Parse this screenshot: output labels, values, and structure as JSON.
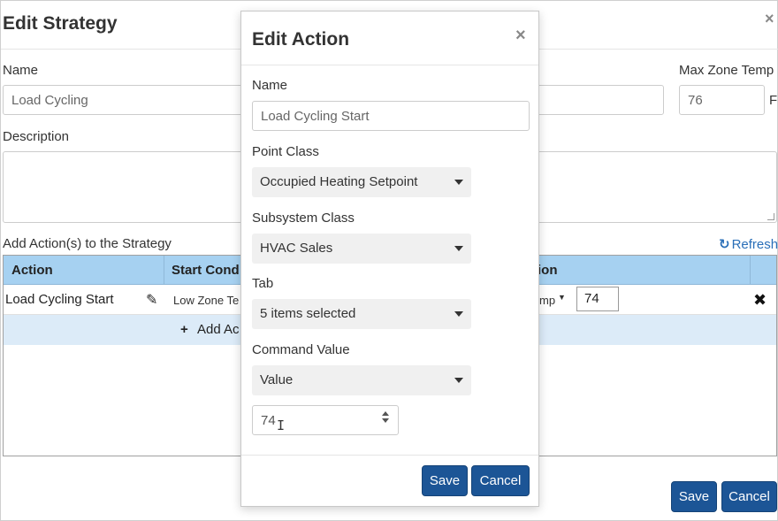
{
  "strategy": {
    "title": "Edit Strategy",
    "name_label": "Name",
    "name_value": "Load Cycling",
    "max_zone_temp_label": "Max Zone Temp",
    "max_zone_temp_value": "76",
    "max_zone_temp_unit": "F°",
    "description_label": "Description",
    "description_value": "",
    "actions_label": "Add Action(s) to the Strategy",
    "refresh_label": "Refresh",
    "save_label": "Save",
    "cancel_label": "Cancel"
  },
  "grid": {
    "headers": [
      "Action",
      "Start Cond",
      "ion"
    ],
    "row": {
      "action": "Load Cycling Start",
      "start_condition": "Low Zone Te",
      "condition_select": "mp",
      "condition_value": "74"
    },
    "add_label": "Add Ac"
  },
  "action_modal": {
    "title": "Edit Action",
    "name_label": "Name",
    "name_value": "Load Cycling Start",
    "point_class_label": "Point Class",
    "point_class_value": "Occupied Heating Setpoint",
    "subsystem_class_label": "Subsystem Class",
    "subsystem_class_value": "HVAC Sales",
    "tab_label": "Tab",
    "tab_value": "5 items selected",
    "command_value_label": "Command Value",
    "command_value_type": "Value",
    "command_value_number": "74",
    "save_label": "Save",
    "cancel_label": "Cancel"
  }
}
